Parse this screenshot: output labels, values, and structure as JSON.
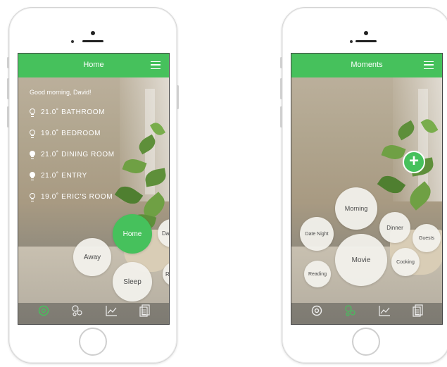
{
  "home_screen": {
    "title": "Home",
    "greeting": "Good morning, David!",
    "rooms": [
      {
        "label": "21.0˚ BATHROOM",
        "light_on": false
      },
      {
        "label": "19.0˚ BEDROOM",
        "light_on": false
      },
      {
        "label": "21.0˚ DINING ROOM",
        "light_on": true
      },
      {
        "label": "21.0˚ ENTRY",
        "light_on": true
      },
      {
        "label": "19.0˚ ERIC'S ROOM",
        "light_on": false
      }
    ],
    "bubbles": {
      "home": "Home",
      "away": "Away",
      "sleep": "Sleep",
      "date_partial": "Dat",
      "re_partial": "Re"
    },
    "nav": [
      "at-icon",
      "moments-icon",
      "chart-icon",
      "docs-icon"
    ],
    "active_nav": "at-icon"
  },
  "moments_screen": {
    "title": "Moments",
    "add_label": "+",
    "bubbles": {
      "morning": "Morning",
      "dinner": "Dinner",
      "guests": "Guests",
      "date_night": "Date Night",
      "movie": "Movie",
      "cooking": "Cooking",
      "reading": "Reading"
    },
    "nav": [
      "at-icon",
      "moments-icon",
      "chart-icon",
      "docs-icon"
    ],
    "active_nav": "moments-icon"
  },
  "colors": {
    "accent": "#46c15c",
    "bubble": "#f2f1ec",
    "text_dark": "#4a4a4a"
  }
}
